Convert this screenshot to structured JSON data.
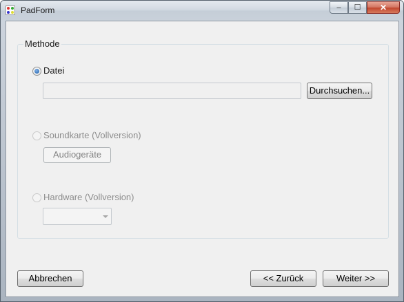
{
  "window": {
    "title": "PadForm",
    "controls": {
      "minimize": "–",
      "maximize": "☐",
      "close": "✕"
    }
  },
  "method_group": {
    "legend": "Methode",
    "options": [
      {
        "label": "Datei",
        "checked": true,
        "enabled": true
      },
      {
        "label": "Soundkarte (Vollversion)",
        "checked": false,
        "enabled": false
      },
      {
        "label": "Hardware (Vollversion)",
        "checked": false,
        "enabled": false
      }
    ],
    "file_path_value": "",
    "browse_button": "Durchsuchen...",
    "audio_devices_button": "Audiogeräte",
    "hardware_select_value": ""
  },
  "footer": {
    "cancel": "Abbrechen",
    "back": "<< Zurück",
    "next": "Weiter >>"
  }
}
